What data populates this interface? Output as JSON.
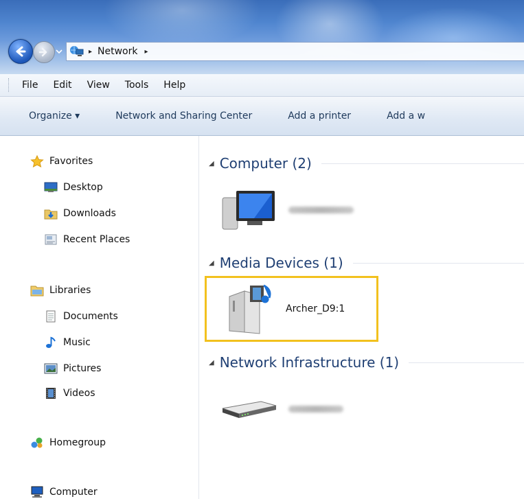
{
  "breadcrumb": {
    "location": "Network",
    "sep1": "▸",
    "sep2": "▸"
  },
  "menu": [
    "File",
    "Edit",
    "View",
    "Tools",
    "Help"
  ],
  "toolbar": {
    "organize": "Organize ▾",
    "network_sharing": "Network and Sharing Center",
    "add_printer": "Add a printer",
    "add_wireless": "Add a w"
  },
  "nav": {
    "favorites": "Favorites",
    "desktop": "Desktop",
    "downloads": "Downloads",
    "recent_places": "Recent Places",
    "libraries": "Libraries",
    "documents": "Documents",
    "music": "Music",
    "pictures": "Pictures",
    "videos": "Videos",
    "homegroup": "Homegroup",
    "computer": "Computer"
  },
  "groups": {
    "computer": "Computer (2)",
    "media": "Media Devices (1)",
    "infra": "Network Infrastructure (1)"
  },
  "devices": {
    "media_device": "Archer_D9:1"
  },
  "colors": {
    "highlight": "#f2c11e",
    "group_title": "#1f3f73"
  }
}
